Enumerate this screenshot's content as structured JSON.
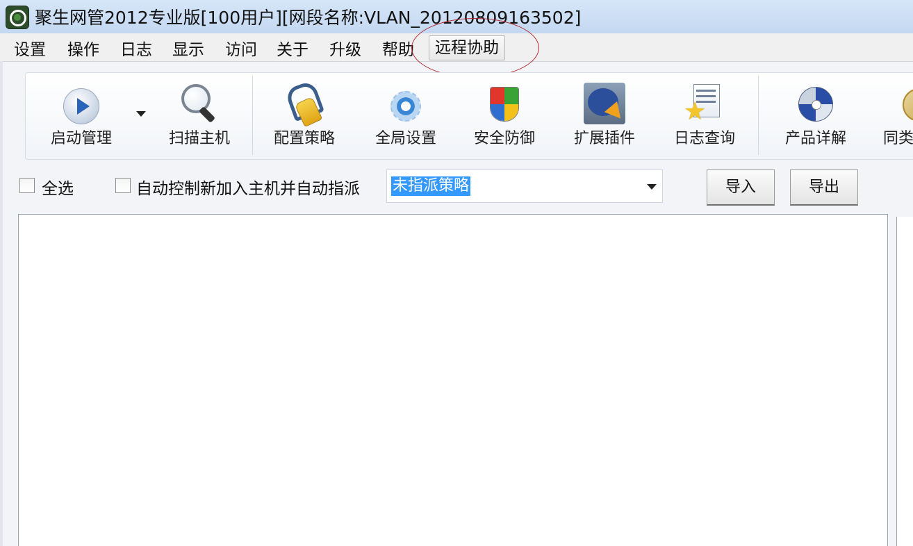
{
  "window": {
    "title": "聚生网管2012专业版[100用户][网段名称:VLAN_20120809163502]"
  },
  "menu": {
    "items": [
      "设置",
      "操作",
      "日志",
      "显示",
      "访问",
      "关于",
      "升级",
      "帮助"
    ],
    "remote_assist": "远程协助"
  },
  "toolbar": {
    "start_manage": "启动管理",
    "scan_host": "扫描主机",
    "config_policy": "配置策略",
    "global_settings": "全局设置",
    "security_defense": "安全防御",
    "extension_plugins": "扩展插件",
    "log_query": "日志查询",
    "product_details": "产品详解",
    "similar": "同类"
  },
  "icons": {
    "start_manage": "play-icon",
    "scan_host": "magnifier-icon",
    "config_policy": "key-icon",
    "global_settings": "gear-icon",
    "security_defense": "shield-icon",
    "extension_plugins": "plugin-icon",
    "log_query": "log-star-icon",
    "product_details": "cd-icon",
    "similar": "medal-icon"
  },
  "options": {
    "select_all": "全选",
    "select_all_checked": false,
    "auto_control": "自动控制新加入主机并自动指派",
    "auto_control_checked": false,
    "policy_selected": "未指派策略",
    "import": "导入",
    "export": "导出"
  },
  "colors": {
    "selection": "#3399ff",
    "annotation_circle": "#b3262e",
    "titlebar": "#c3d8f1"
  }
}
